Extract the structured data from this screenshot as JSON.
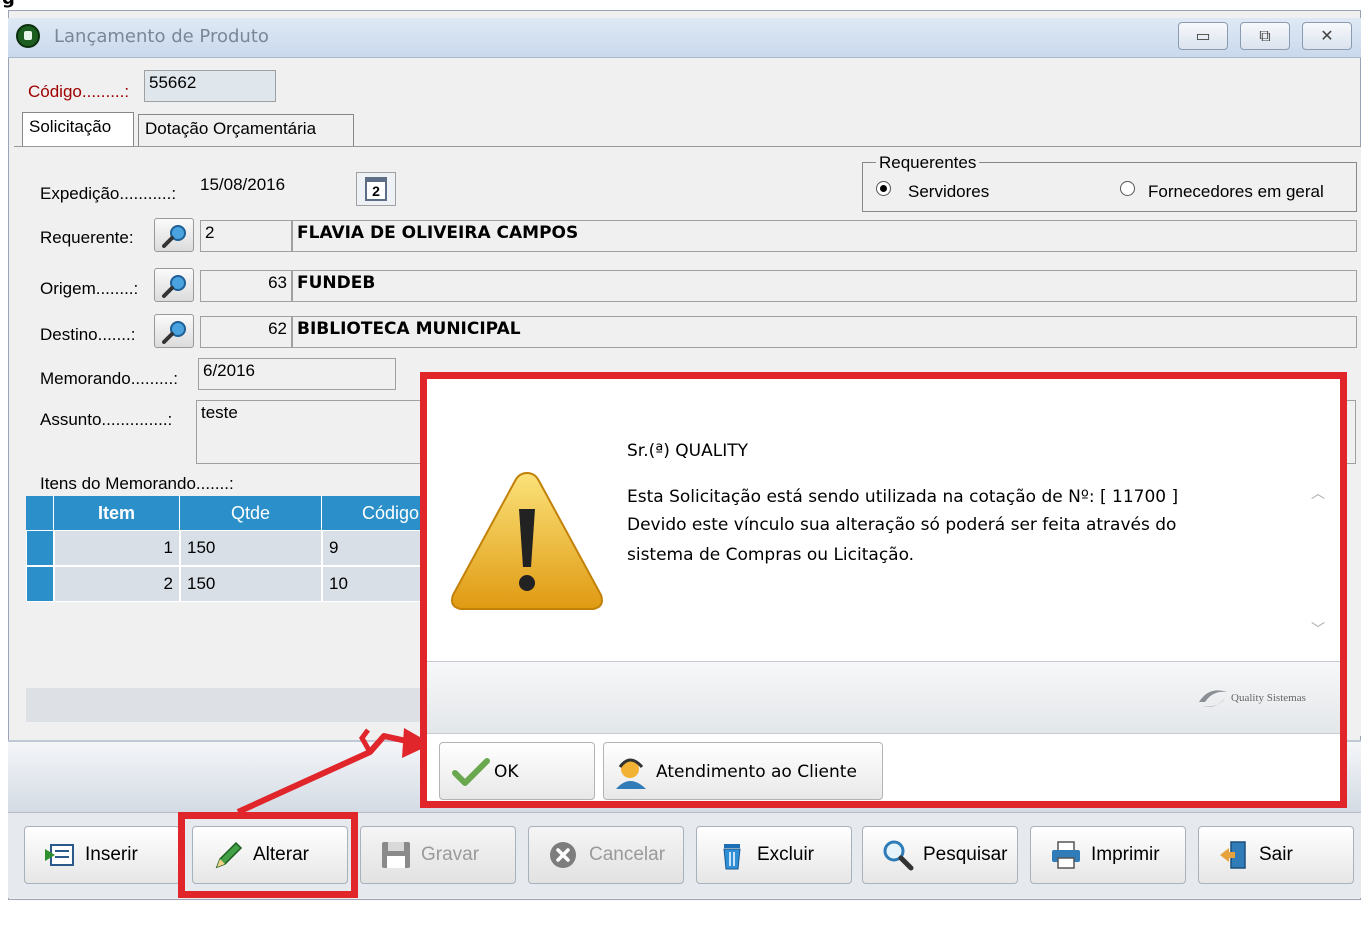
{
  "window": {
    "title": "Lançamento de Produto",
    "minimize": "▭",
    "restore": "⧉",
    "close": "✕"
  },
  "top_cut_text": "g",
  "codigo": {
    "label": "Código.........:",
    "value": "55662"
  },
  "tabs": [
    "Solicitação",
    "Dotação Orçamentária"
  ],
  "form": {
    "expedicao_label": "Expedição...........:",
    "expedicao_value": "15/08/2016",
    "calendar_day": "2",
    "requerente_label": "Requerente:",
    "requerente_code": "2",
    "requerente_name": "FLAVIA DE OLIVEIRA CAMPOS",
    "origem_label": "Origem........:",
    "origem_code": "63",
    "origem_name": "FUNDEB",
    "destino_label": "Destino.......:",
    "destino_code": "62",
    "destino_name": "BIBLIOTECA MUNICIPAL",
    "memorando_label": "Memorando.........:",
    "memorando_value": "6/2016",
    "assunto_label": "Assunto..............:",
    "assunto_value": "teste",
    "itens_label": "Itens do Memorando.......:"
  },
  "requerentes": {
    "legend": "Requerentes",
    "option1": "Servidores",
    "option2": "Fornecedores em geral",
    "selected": "Servidores"
  },
  "grid": {
    "headers": [
      "Item",
      "Qtde",
      "Código"
    ],
    "rows": [
      {
        "item": "1",
        "qtde": "150",
        "codigo": "9"
      },
      {
        "item": "2",
        "qtde": "150",
        "codigo": "10"
      }
    ]
  },
  "dialog": {
    "greeting": "Sr.(ª) QUALITY",
    "line1": "Esta Solicitação está sendo utilizada na cotação de Nº: [ 11700 ]",
    "line2": "Devido este vínculo sua alteração só poderá ser feita através do",
    "line3": "sistema de Compras ou Licitação.",
    "brand": "Quality Sistemas",
    "ok_label": "OK",
    "support_label": "Atendimento ao Cliente"
  },
  "toolbar": {
    "inserir": "Inserir",
    "alterar": "Alterar",
    "gravar": "Gravar",
    "cancelar": "Cancelar",
    "excluir": "Excluir",
    "pesquisar": "Pesquisar",
    "imprimir": "Imprimir",
    "sair": "Sair"
  },
  "colors": {
    "highlight_red": "#e0252b",
    "grid_blue": "#2b8fc9",
    "field_gray": "#f0f0f0"
  }
}
